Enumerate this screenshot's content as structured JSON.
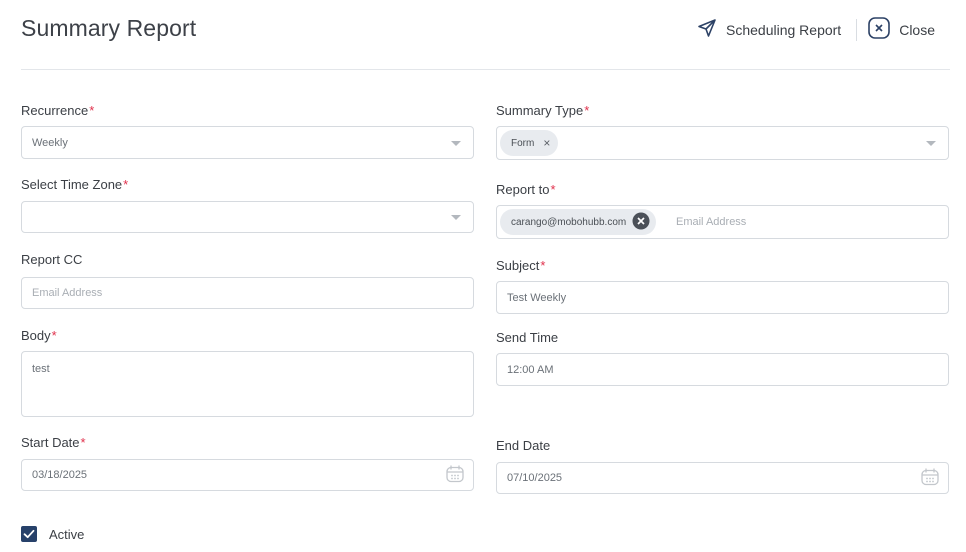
{
  "header": {
    "title": "Summary Report",
    "scheduling_label": "Scheduling Report",
    "close_label": "Close"
  },
  "form": {
    "recurrence": {
      "label": "Recurrence",
      "value": "Weekly"
    },
    "summary_type": {
      "label": "Summary Type",
      "chip": "Form"
    },
    "time_zone": {
      "label": "Select Time Zone",
      "value": ""
    },
    "report_to": {
      "label": "Report to",
      "chip": "carango@mobohubb.com",
      "placeholder": "Email Address"
    },
    "report_cc": {
      "label": "Report CC",
      "placeholder": "Email Address"
    },
    "subject": {
      "label": "Subject",
      "value": "Test Weekly"
    },
    "body": {
      "label": "Body",
      "value": "test"
    },
    "send_time": {
      "label": "Send Time",
      "value": "12:00 AM"
    },
    "start_date": {
      "label": "Start Date",
      "value": "03/18/2025"
    },
    "end_date": {
      "label": "End Date",
      "value": "07/10/2025"
    },
    "active": {
      "label": "Active",
      "checked": true
    },
    "required_mark": "*"
  },
  "colors": {
    "accent": "#27416a",
    "required": "#e0304b",
    "border": "#d6dadf"
  },
  "icons": {
    "scheduling": "send-icon",
    "close": "close-circle-icon",
    "calendar": "calendar-icon",
    "checkbox": "check-icon"
  }
}
